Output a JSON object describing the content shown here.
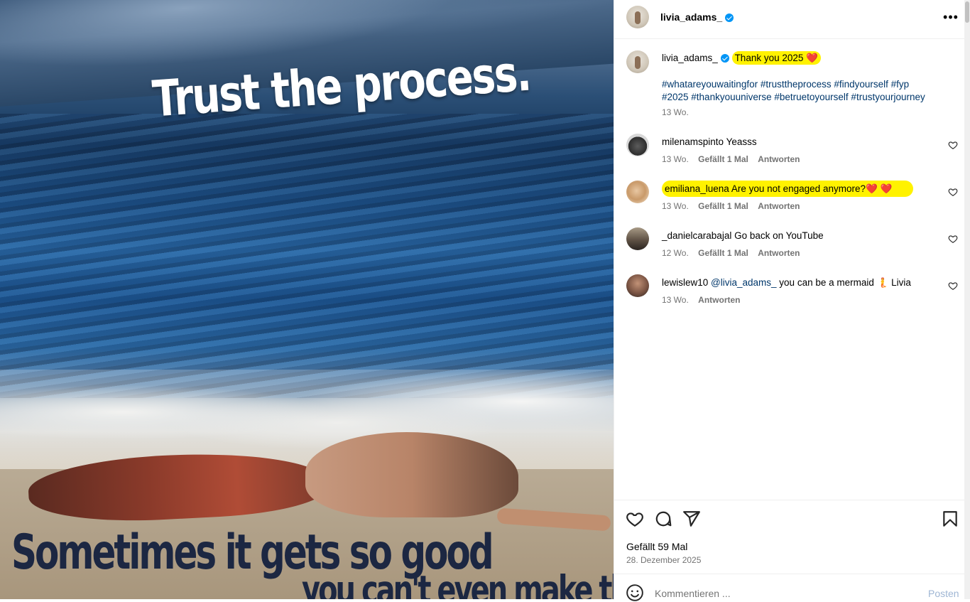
{
  "image": {
    "headline": "Trust the process.",
    "caption_line1": "Sometimes it gets so good",
    "caption_line2": "you can't even make that up"
  },
  "header": {
    "username": "livia_adams_",
    "more_icon": "more-horizontal-icon"
  },
  "post": {
    "username": "livia_adams_",
    "text": "Thank you 2025 ❤️",
    "hashtags_line1": "#whatareyouwaitingfor #trusttheprocess #findyourself #fyp",
    "hashtags_line2": "#2025 #thankyouuniverse #betruetoyourself #trustyourjourney",
    "time": "13 Wo."
  },
  "comments": [
    {
      "username": "milenamspinto",
      "text": "Yeasss",
      "time": "13 Wo.",
      "likes": "Gefällt 1 Mal",
      "reply": "Antworten"
    },
    {
      "username": "emiliana_luena",
      "text": "Are you not engaged anymore?❤️ ❤️",
      "time": "13 Wo.",
      "likes": "Gefällt 1 Mal",
      "reply": "Antworten"
    },
    {
      "username": "_danielcarabajal",
      "text": "Go back on YouTube",
      "time": "12 Wo.",
      "likes": "Gefällt 1 Mal",
      "reply": "Antworten"
    },
    {
      "username": "lewislew10",
      "mention": "@livia_adams_",
      "text": " you can be a mermaid 🧜 Livia",
      "time": "13 Wo.",
      "reply": "Antworten"
    }
  ],
  "actions": {
    "like_icon": "heart-icon",
    "comment_icon": "comment-icon",
    "share_icon": "send-icon",
    "save_icon": "bookmark-icon"
  },
  "footer": {
    "likes": "Gefällt 59 Mal",
    "date": "28. Dezember 2025",
    "comment_placeholder": "Kommentieren ...",
    "post_label": "Posten"
  },
  "colors": {
    "verified": "#0095f6",
    "highlight": "#fff200",
    "link": "#00376b",
    "heart": "#e0245e"
  }
}
